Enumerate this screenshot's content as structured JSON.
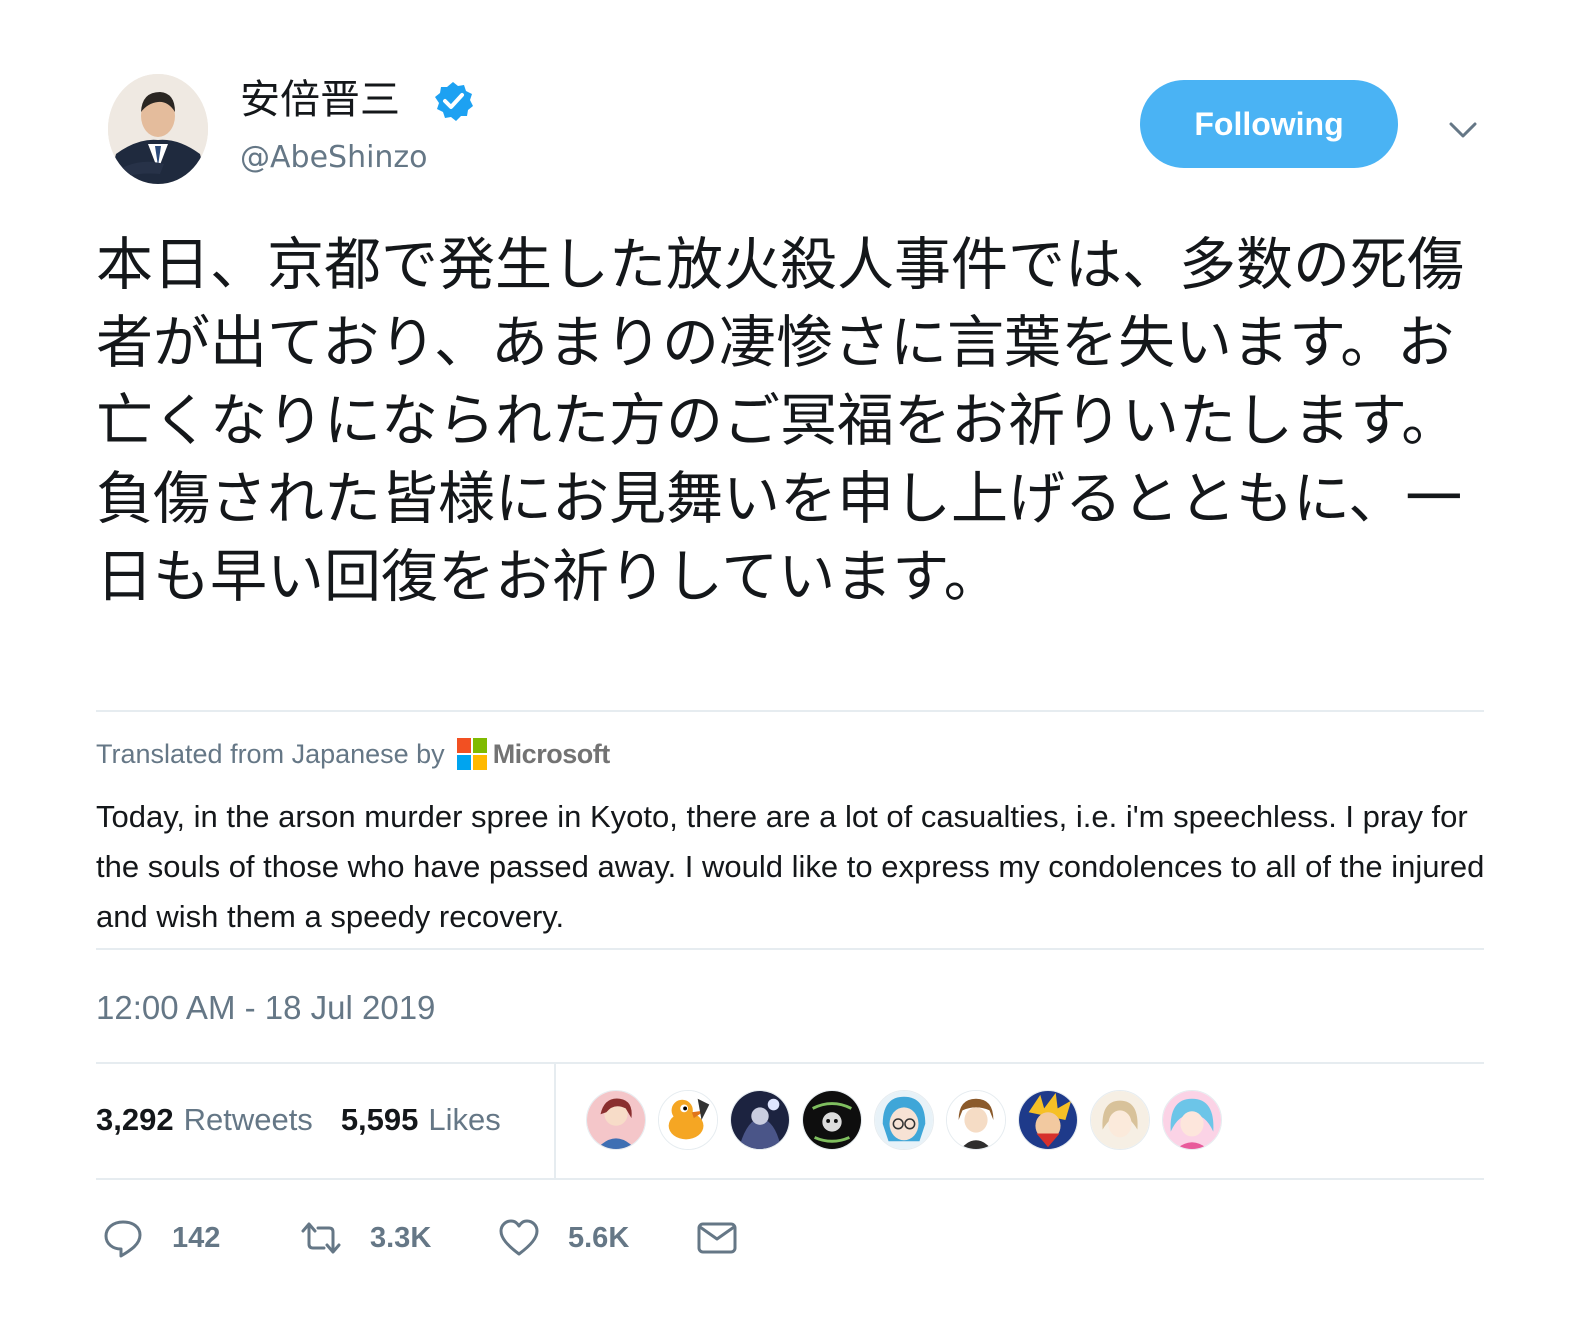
{
  "user": {
    "display_name": "安倍晋三",
    "handle": "@AbeShinzo",
    "verified": true,
    "avatar": "profile-photo"
  },
  "header": {
    "follow_label": "Following",
    "menu_icon": "chevron-down-icon"
  },
  "tweet": {
    "text": "本日、京都で発生した放火殺人事件では、多数の死傷者が出ており、あまりの凄惨さに言葉を失います。お亡くなりになられた方のご冥福をお祈りいたします。負傷された皆様にお見舞いを申し上げるとともに、一日も早い回復をお祈りしています。"
  },
  "translation": {
    "label": "Translated from Japanese by",
    "provider": "Microsoft",
    "text": "Today, in the arson murder spree in Kyoto, there are a lot of casualties, i.e. i'm speechless. I pray for the souls of those who have passed away. I would like to express my condolences to all of the injured and wish them a speedy recovery."
  },
  "timestamp": "12:00 AM - 18 Jul 2019",
  "stats": {
    "retweets_count": "3,292",
    "retweets_label": "Retweets",
    "likes_count": "5,595",
    "likes_label": "Likes"
  },
  "likers": [
    "liker-avatar",
    "liker-avatar",
    "liker-avatar",
    "liker-avatar",
    "liker-avatar",
    "liker-avatar",
    "liker-avatar",
    "liker-avatar",
    "liker-avatar"
  ],
  "actions": {
    "reply_count": "142",
    "retweet_count": "3.3K",
    "like_count": "5.6K"
  },
  "colors": {
    "accent": "#4ab3f4",
    "text": "#14171a",
    "muted": "#657786",
    "divider": "#e6ecf0",
    "verified": "#1da1f2"
  }
}
